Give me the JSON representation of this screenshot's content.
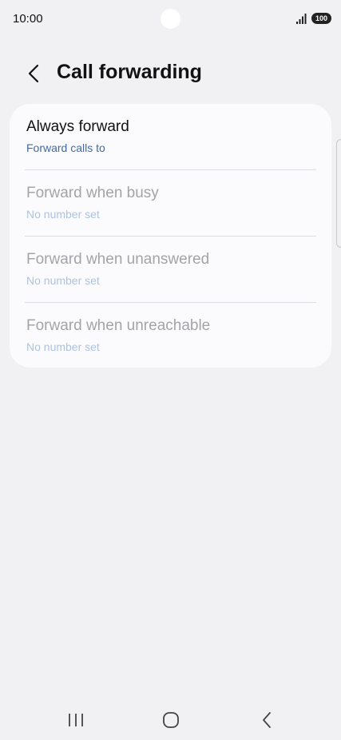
{
  "status_bar": {
    "time": "10:00",
    "battery": "100",
    "icons": [
      "signal-icon",
      "battery-icon"
    ]
  },
  "header": {
    "back_icon": "chevron-left-icon",
    "title": "Call forwarding"
  },
  "items": [
    {
      "title": "Always forward",
      "subtitle": "Forward calls to",
      "enabled": true
    },
    {
      "title": "Forward when busy",
      "subtitle": "No number set",
      "enabled": false
    },
    {
      "title": "Forward when unanswered",
      "subtitle": "No number set",
      "enabled": false
    },
    {
      "title": "Forward when unreachable",
      "subtitle": "No number set",
      "enabled": false
    }
  ],
  "nav_bar": {
    "icons": [
      "recents-icon",
      "home-icon",
      "back-icon"
    ]
  },
  "colors": {
    "background": "#f1f1f3",
    "card": "#fbfbfe",
    "accent": "#3f6aa6",
    "disabled_text": "#a4a4a7"
  }
}
